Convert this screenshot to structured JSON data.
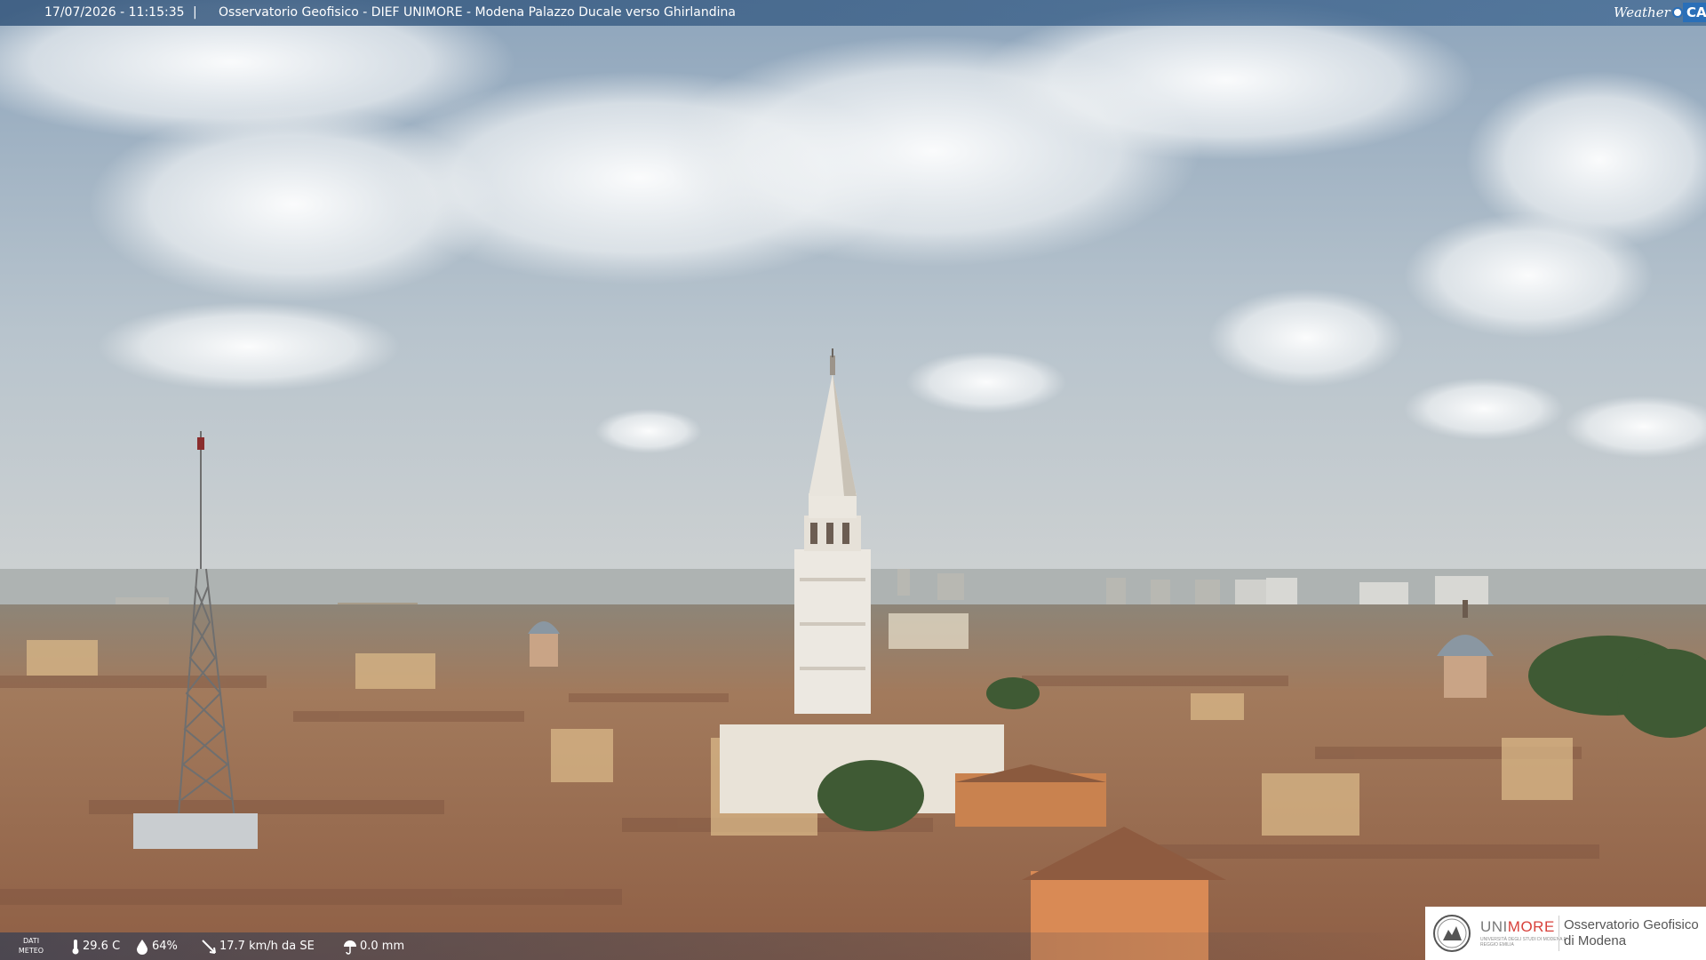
{
  "header": {
    "datetime": "17/07/2026 - 11:15:35",
    "separator": "|",
    "caption": "Osservatorio Geofisico - DIEF UNIMORE - Modena Palazzo Ducale verso Ghirlandina"
  },
  "brand": {
    "weather": "Weather",
    "cam": "CAM"
  },
  "weather": {
    "label_line1": "DATI",
    "label_line2": "METEO",
    "temperature": "29.6 C",
    "humidity": "64%",
    "wind": "17.7 km/h da SE",
    "rain": "0.0 mm"
  },
  "logo": {
    "uni_prefix": "UNI",
    "uni_suffix": "MORE",
    "uni_sub": "UNIVERSITÀ DEGLI STUDI DI MODENA E REGGIO EMILIA",
    "observatory_line1": "Osservatorio Geofisico",
    "observatory_line2": "di Modena"
  },
  "colors": {
    "sky_top": "#8fa6bd",
    "sky_bottom": "#c9ced2",
    "roofs": "#9c6a4e",
    "tower": "#e8e3da",
    "unimore_red": "#d8413b",
    "weathercam_blue": "#2a6fb8"
  }
}
